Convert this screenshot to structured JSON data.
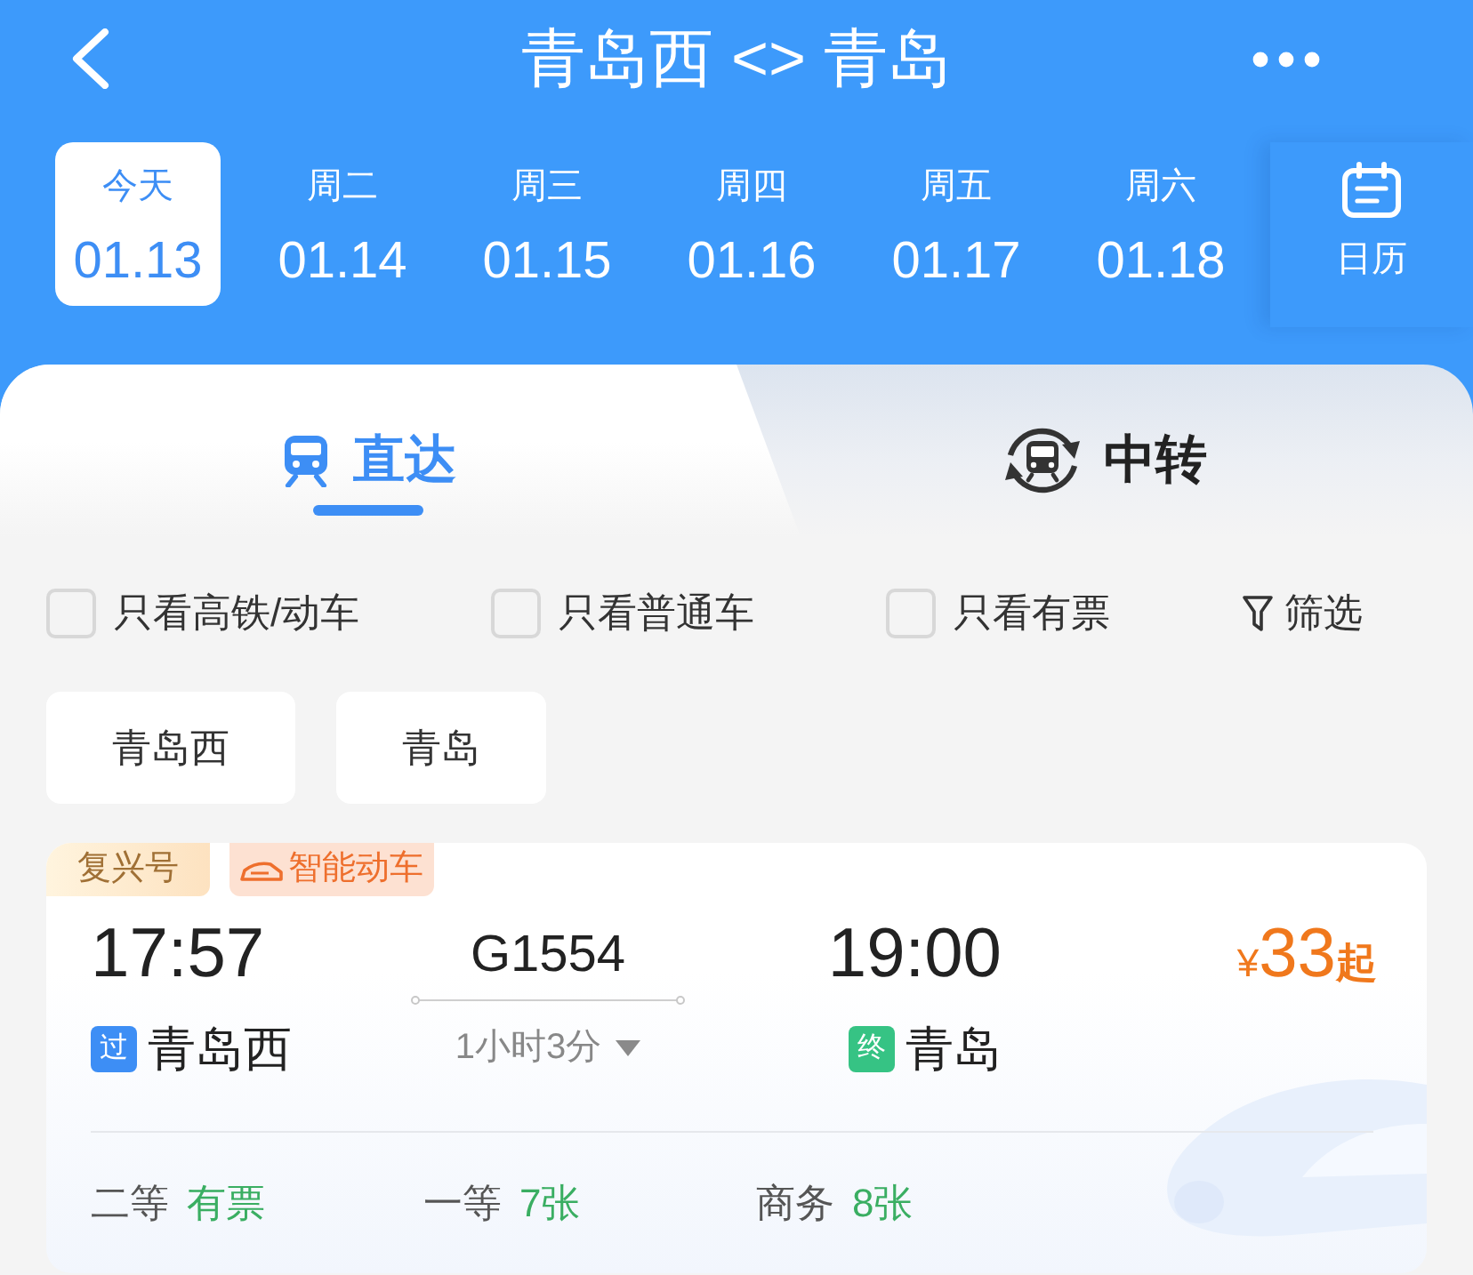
{
  "header": {
    "title": "青岛西 <> 青岛"
  },
  "dates": [
    {
      "weekday": "今天",
      "date": "01.13",
      "selected": true
    },
    {
      "weekday": "周二",
      "date": "01.14",
      "selected": false
    },
    {
      "weekday": "周三",
      "date": "01.15",
      "selected": false
    },
    {
      "weekday": "周四",
      "date": "01.16",
      "selected": false
    },
    {
      "weekday": "周五",
      "date": "01.17",
      "selected": false
    },
    {
      "weekday": "周六",
      "date": "01.18",
      "selected": false
    }
  ],
  "calendar": {
    "label": "日历"
  },
  "tabs": [
    {
      "kind": "direct",
      "label": "直达",
      "selected": true
    },
    {
      "kind": "transfer",
      "label": "中转",
      "selected": false
    }
  ],
  "filters": [
    {
      "kind": "checkbox",
      "label": "只看高铁/动车",
      "checked": false
    },
    {
      "kind": "checkbox",
      "label": "只看普通车",
      "checked": false
    },
    {
      "kind": "checkbox",
      "label": "只看有票",
      "checked": false
    },
    {
      "kind": "filter",
      "label": "筛选"
    }
  ],
  "stations": [
    {
      "label": "青岛西"
    },
    {
      "label": "青岛"
    }
  ],
  "trains": [
    {
      "tags": [
        {
          "kind": "fuxing",
          "label": "复兴号"
        },
        {
          "kind": "smart",
          "label": "智能动车"
        }
      ],
      "departure": {
        "time": "17:57",
        "kind": "pass",
        "badge": "过",
        "station": "青岛西"
      },
      "train_no": "G1554",
      "duration": "1小时3分",
      "arrival": {
        "time": "19:00",
        "kind": "terminal",
        "badge": "终",
        "station": "青岛"
      },
      "price": {
        "symbol": "¥",
        "amount": "33",
        "suffix": "起"
      },
      "seats": [
        {
          "class": "二等",
          "availability": "有票"
        },
        {
          "class": "一等",
          "availability": "7张"
        },
        {
          "class": "商务",
          "availability": "8张"
        }
      ]
    }
  ]
}
